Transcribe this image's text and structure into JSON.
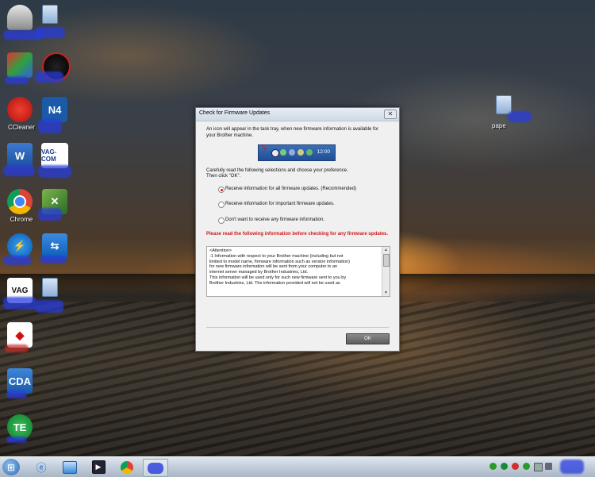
{
  "dialog": {
    "title": "Check for Firmware Updates",
    "close_label": "✕",
    "intro": "An icon will appear in the task tray, when new firmware information is available for your Brother machine.",
    "tray_clock": "12:00",
    "instructions": "Carefully read the following selections and choose your preference.",
    "instructions2": "Then click \"OK\".",
    "options": [
      "Receive information for all firmware updates. (Recommended)",
      "Receive information for important firmware updates.",
      "Don't want to receive any firmware information."
    ],
    "warning": "Please read the following information before checking for any firmware updates.",
    "attention": [
      "<Attention>",
      " -1 Information with respect to your Brother machine (including but not",
      "limited to model name, firmware information such as version information)",
      "for new firmware information will be sent  from your computer  to an",
      "internet server managed by Brother Industries, Ltd.",
      "This information will be used only for such new firmware sent to you by",
      "Brother Industries, Ltd. The information provided will not be used as"
    ],
    "ok_label": "OK"
  },
  "desktop_icons": [
    {
      "name": "recycle-bin",
      "label": ""
    },
    {
      "name": "folder-top",
      "label": ""
    },
    {
      "name": "app-2",
      "label": ""
    },
    {
      "name": "app-speedometer",
      "label": ""
    },
    {
      "name": "ccleaner",
      "label": "CC"
    },
    {
      "name": "n4",
      "label": "N4"
    },
    {
      "name": "word",
      "label": "W"
    },
    {
      "name": "vag-com",
      "label": "VAG-COM"
    },
    {
      "name": "chrome",
      "label": "Chrome"
    },
    {
      "name": "tool",
      "label": ""
    },
    {
      "name": "app-lightning",
      "label": ""
    },
    {
      "name": "teamviewer",
      "label": ""
    },
    {
      "name": "vag",
      "label": "VAG"
    },
    {
      "name": "folder-2",
      "label": ""
    },
    {
      "name": "mitsubishi",
      "label": ""
    },
    {
      "name": "cda",
      "label": "CDA"
    },
    {
      "name": "te",
      "label": "TE"
    }
  ],
  "right_folder_label": "pape",
  "colors": {
    "accent": "#2f6bb0",
    "warning": "#d01818",
    "tray_bg": "#1f4e94"
  }
}
